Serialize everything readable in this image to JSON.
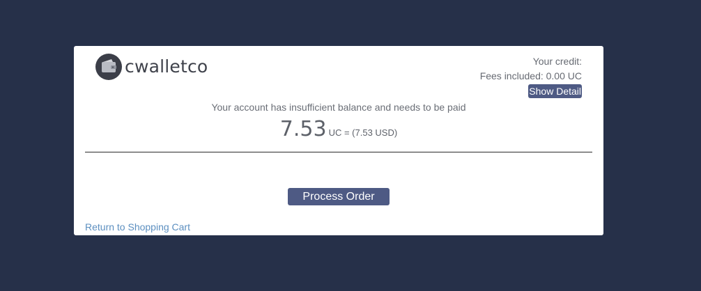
{
  "brand": {
    "name": "cwalletco",
    "icon": "wallet-icon"
  },
  "credit": {
    "label": "Your credit:",
    "fees": "Fees included: 0.00 UC",
    "detail_button": "Show Detail"
  },
  "payment": {
    "message": "Your account has insufficient balance and needs to be paid",
    "amount": "7.53",
    "unit": "UC = (7.53 USD)"
  },
  "actions": {
    "process_order": "Process Order",
    "return_link": "Return to Shopping Cart"
  },
  "colors": {
    "background": "#263049",
    "card": "#ffffff",
    "button": "#4e5a84",
    "link": "#5c8fc0"
  }
}
